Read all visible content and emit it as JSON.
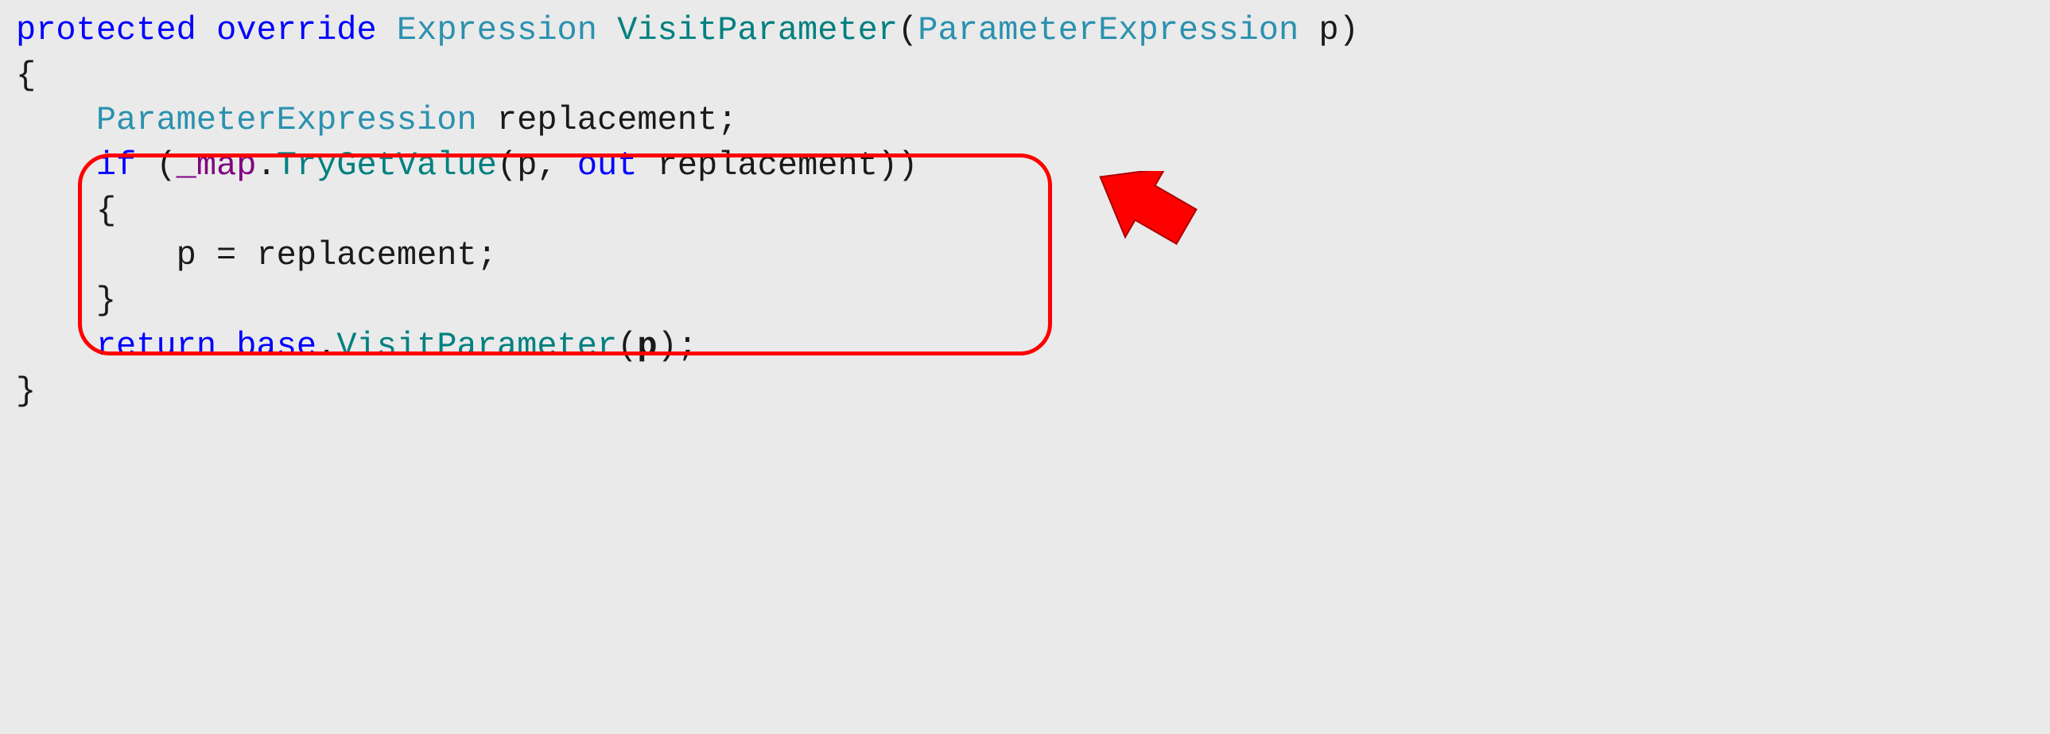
{
  "code": {
    "line1": {
      "kw1": "protected",
      "kw2": "override",
      "type1": "Expression",
      "method1": "VisitParameter",
      "paren_open": "(",
      "type2": "ParameterExpression",
      "param1": " p",
      "paren_close": ")"
    },
    "line2": "{",
    "line3": {
      "indent": "    ",
      "type1": "ParameterExpression",
      "rest": " replacement;"
    },
    "line4": "",
    "line5": {
      "indent": "    ",
      "kw1": "if",
      "paren_open": " (",
      "field1": "_map",
      "dot": ".",
      "method1": "TryGetValue",
      "paren2_open": "(",
      "arg1": "p, ",
      "kw2": "out",
      "arg2": " replacement",
      "paren2_close": ")",
      "paren_close": ")"
    },
    "line6": {
      "indent": "    ",
      "brace": "{"
    },
    "line7": {
      "indent": "        ",
      "stmt": "p = replacement;"
    },
    "line8": {
      "indent": "    ",
      "brace": "}"
    },
    "line9": "",
    "line10": {
      "indent": "    ",
      "kw1": "return",
      "sp": " ",
      "kw2": "base",
      "dot": ".",
      "method1": "VisitParameter",
      "paren_open": "(",
      "arg": "p",
      "paren_close": ")",
      "semi": ";"
    },
    "line11": "}"
  },
  "annotations": {
    "highlight": "if-trygetvalue-block",
    "arrow_target": "highlight-box"
  }
}
